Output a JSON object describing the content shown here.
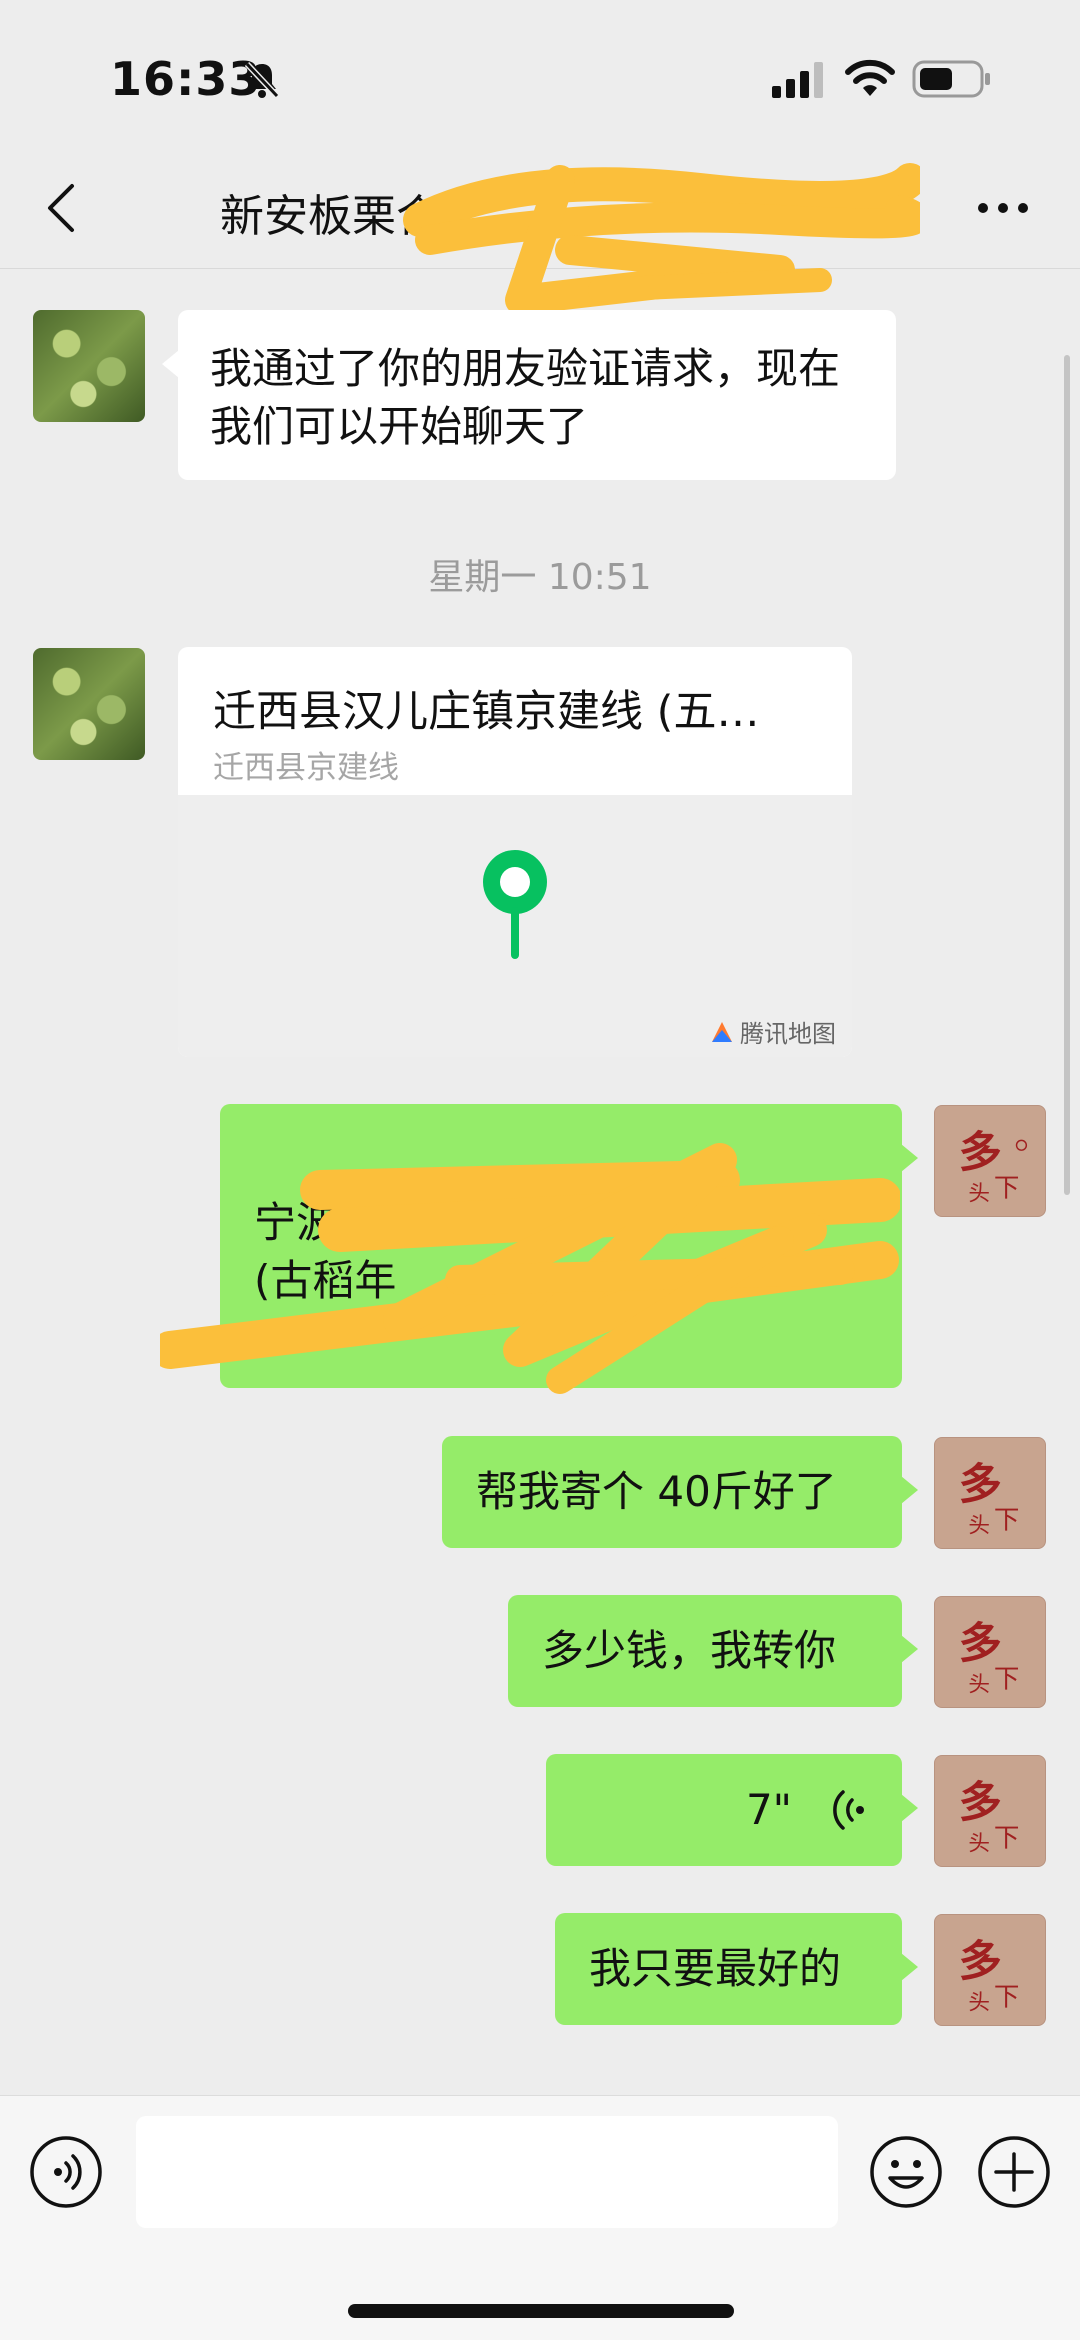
{
  "status_bar": {
    "time": "16:33"
  },
  "nav": {
    "title": "新安板栗合"
  },
  "messages": {
    "welcome": "我通过了你的朋友验证请求，现在我们可以开始聊天了",
    "timestamp": "星期一 10:51",
    "location": {
      "title": "迁西县汉儿庄镇京建线 (五…",
      "subtitle": "迁西县京建线",
      "map_brand": "腾讯地图"
    },
    "redacted_address_visible": "宁波市",
    "redacted_address_line2": "(古稻年",
    "msg_40jin": "帮我寄个 40斤好了",
    "msg_price": "多少钱，我转你",
    "voice_duration": "7\"",
    "msg_best": "我只要最好的"
  },
  "colors": {
    "chat_bg": "#ededed",
    "bubble_green": "#95ec69",
    "bubble_white": "#ffffff",
    "pin_green": "#07c160",
    "scribble": "#fbbf3b"
  },
  "icons": [
    "mute-icon",
    "signal-icon",
    "wifi-icon",
    "battery-icon",
    "back-icon",
    "more-icon",
    "location-pin-icon",
    "voice-wave-icon",
    "voice-input-icon",
    "emoji-icon",
    "plus-icon"
  ]
}
